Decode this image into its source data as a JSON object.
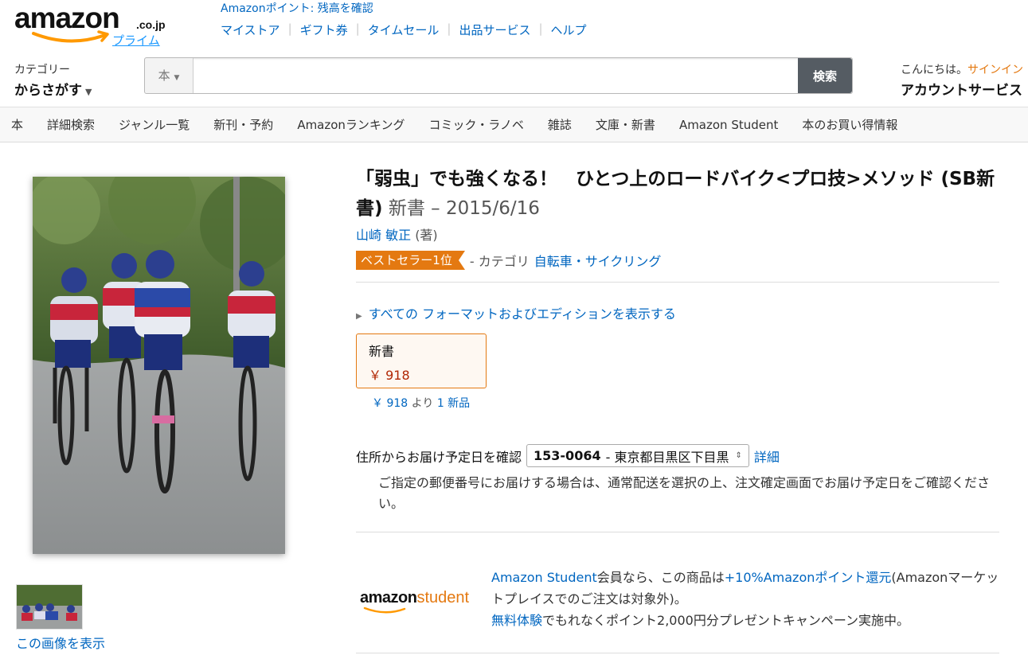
{
  "header": {
    "logo_word": "amazon",
    "logo_tld": ".co.jp",
    "logo_prime": "プライム",
    "points_link": "Amazonポイント: 残高を確認",
    "nav_links": [
      "マイストア",
      "ギフト券",
      "タイムセール",
      "出品サービス",
      "ヘルプ"
    ]
  },
  "search": {
    "category_label": "カテゴリー",
    "category_value": "からさがす",
    "scope": "本",
    "placeholder": "",
    "button_label": "検索"
  },
  "account": {
    "greeting": "こんにちは。",
    "signin": "サインイン",
    "services": "アカウントサービス"
  },
  "subnav": {
    "items": [
      "本",
      "詳細検索",
      "ジャンル一覧",
      "新刊・予約",
      "Amazonランキング",
      "コミック・ラノベ",
      "雑誌",
      "文庫・新書",
      "Amazon Student",
      "本のお買い得情報"
    ]
  },
  "product": {
    "title": "「弱虫」でも強くなる！　ひとつ上のロードバイク<プロ技>メソッド (SB新書)",
    "format": "新書",
    "date": "– 2015/6/16",
    "author": "山崎 敏正",
    "author_role": "(著)",
    "bestseller_badge": "ベストセラー1位",
    "category_prefix": "- カテゴリ",
    "category_link": "自転車・サイクリング",
    "all_formats": "すべての フォーマットおよびエディションを表示する",
    "format_box": {
      "name": "新書",
      "price": "￥ 918"
    },
    "new_offers": {
      "price": "￥ 918",
      "from": "より",
      "count_label": "1 新品"
    },
    "view_image": "この画像を表示"
  },
  "delivery": {
    "label": "住所からお届け予定日を確認",
    "zip": "153-0064",
    "address": "- 東京都目黒区下目黒",
    "detail_link": "詳細",
    "note": "ご指定の郵便番号にお届けする場合は、通常配送を選択の上、注文確定画面でお届け予定日をご確認ください。"
  },
  "student": {
    "logo_amazon": "amazon",
    "logo_student": "student",
    "line1_link": "Amazon Student",
    "line1_text": "会員なら、この商品は",
    "line1_point": "+10%Amazonポイント還元",
    "line1_tail": "(Amazonマーケットプレイスでのご注文は対象外)。",
    "line2_link": "無料体験",
    "line2_text": "でもれなくポイント2,000円分プレゼントキャンペーン実施中。"
  },
  "colors": {
    "accent": "#e47911",
    "link": "#0066c0",
    "price": "#b12704",
    "search_button": "#555c63"
  }
}
